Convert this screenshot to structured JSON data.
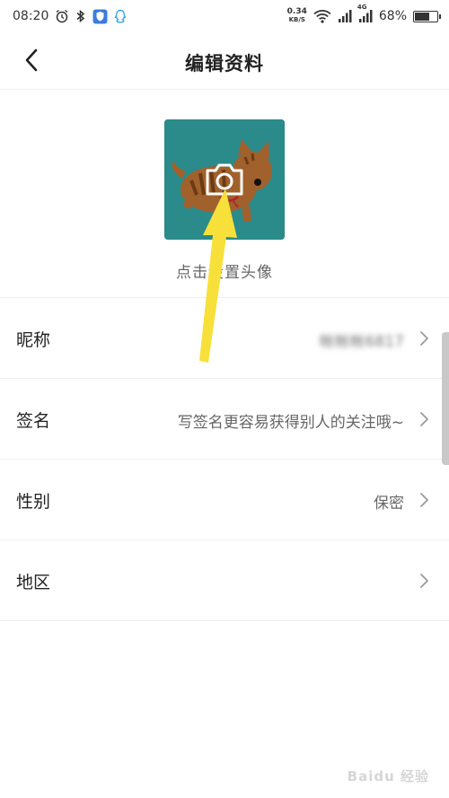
{
  "status_bar": {
    "time": "08:20",
    "net_speed_value": "0.34",
    "net_speed_unit": "KB/S",
    "signal_label": "4G",
    "battery_text": "68%",
    "battery_level": 0.68
  },
  "nav": {
    "title": "编辑资料"
  },
  "avatar": {
    "hint": "点击设置头像",
    "background_color": "#2b8a8a"
  },
  "rows": [
    {
      "label": "昵称",
      "value": "帐帐帐6817"
    },
    {
      "label": "签名",
      "value": "写签名更容易获得别人的关注哦~"
    },
    {
      "label": "性别",
      "value": "保密"
    },
    {
      "label": "地区",
      "value": ""
    }
  ],
  "watermark": "Baidu 经验",
  "colors": {
    "arrow": "#f7e03a",
    "chevron": "#9a9a9a"
  }
}
